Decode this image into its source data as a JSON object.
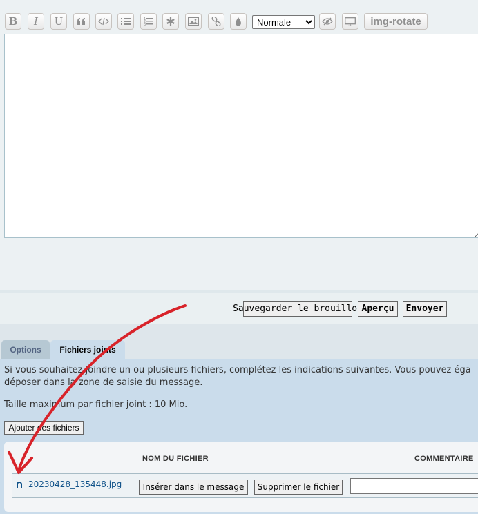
{
  "toolbar": {
    "buttons": [
      {
        "name": "bold-icon",
        "glyph": "B"
      },
      {
        "name": "italic-icon",
        "glyph": "I"
      },
      {
        "name": "underline-icon",
        "glyph": "U"
      },
      {
        "name": "quote-icon"
      },
      {
        "name": "code-icon"
      },
      {
        "name": "bullet-list-icon"
      },
      {
        "name": "numbered-list-icon"
      },
      {
        "name": "asterisk-icon"
      },
      {
        "name": "image-icon"
      },
      {
        "name": "link-icon"
      },
      {
        "name": "color-drop-icon"
      }
    ],
    "font_size": {
      "selected": "Normale"
    },
    "extra_buttons": [
      {
        "name": "hide-eye-icon"
      },
      {
        "name": "monitor-icon"
      }
    ],
    "img_rotate_label": "img-rotate"
  },
  "actions": {
    "save_draft": "Sauvegarder le brouillon",
    "preview": "Aperçu",
    "send": "Envoyer"
  },
  "tabs": {
    "options": "Options",
    "attachments": "Fichiers joints"
  },
  "attachments_panel": {
    "intro_line1": "Si vous souhaitez joindre un ou plusieurs fichiers, complétez les indications suivantes. Vous pouvez éga",
    "intro_line2": "déposer dans la zone de saisie du message.",
    "max_size": "Taille maximum par fichier joint : 10 Mio.",
    "add_files": "Ajouter des fichiers",
    "columns": {
      "filename": "NOM DU FICHIER",
      "comment": "COMMENTAIRE"
    },
    "files": [
      {
        "name": "20230428_135448.jpg",
        "insert": "Insérer dans le message",
        "delete": "Supprimer le fichier",
        "comment": ""
      }
    ]
  },
  "colors": {
    "page_bg": "#ECF1F3",
    "panel_bg": "#CADCEB",
    "link": "#105289",
    "annotation": "#D8232A"
  }
}
